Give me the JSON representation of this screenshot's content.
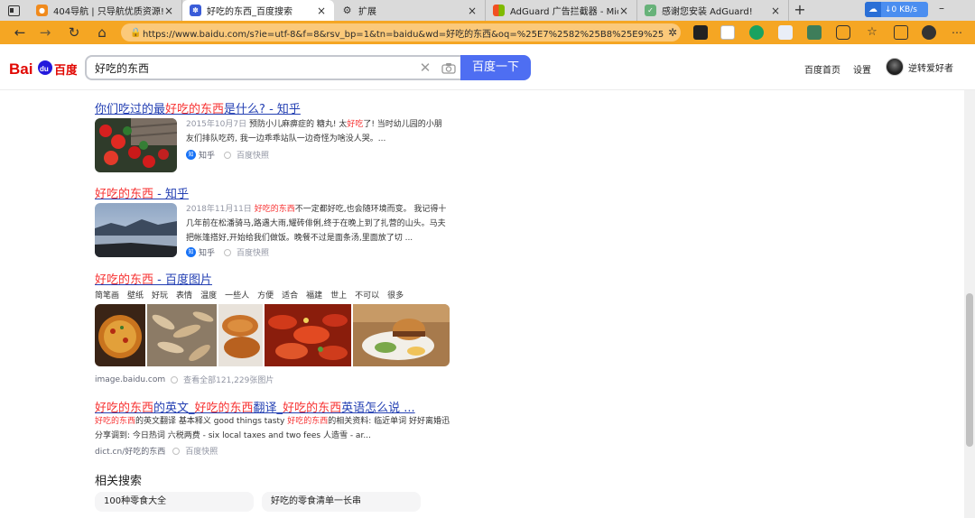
{
  "browser": {
    "tabs": [
      {
        "title": "404导航 | 只导航优质资源!",
        "close": "×"
      },
      {
        "title": "好吃的东西_百度搜索",
        "close": "×"
      },
      {
        "title": "扩展",
        "close": "×"
      },
      {
        "title": "AdGuard 广告拦截器 - Microsoft",
        "close": "×"
      },
      {
        "title": "感谢您安装 AdGuard!",
        "close": "×"
      }
    ],
    "new_tab": "+",
    "cloud_speed": "↓0 KB/s",
    "url": "https://www.baidu.com/s?ie=utf-8&f=8&rsv_bp=1&tn=baidu&wd=好吃的东西&oq=%25E7%2582%25B8%25E9%25B8%25A1...",
    "nav": {
      "back": "←",
      "forward": "→",
      "reload": "↻",
      "home": "⌂"
    }
  },
  "header": {
    "search_query": "好吃的东西",
    "search_button": "百度一下",
    "links": {
      "home": "百度首页",
      "settings": "设置"
    },
    "username": "逆转爱好者"
  },
  "results": [
    {
      "title_pre": "你们吃过的最",
      "title_hl": "好吃的东西",
      "title_post": "是什么? - 知乎",
      "date": "2015年10月7日",
      "snippet_a": "预防小儿麻痹症的 糖丸! 太",
      "snippet_hl": "好吃",
      "snippet_b": "了! 当时幼儿园的小朋友们排队吃药, 我一边乖乖站队一边奇怪为啥没人哭。...",
      "source": "知乎",
      "snapshot": "百度快照"
    },
    {
      "title_hl": "好吃的东西",
      "title_post": " - 知乎",
      "date": "2018年11月11日",
      "snippet_hl": "好吃的东西",
      "snippet_b": "不一定都好吃,也会随环境而变。 我记得十几年前在松潘骑马,路遇大雨,耀砖俳俐,终于在晚上到了扎营的山头。马夫把帐篷搭好,开始给我们做饭。晚餐不过是面条汤,里面放了切 ...",
      "source": "知乎",
      "snapshot": "百度快照"
    }
  ],
  "image_result": {
    "title_hl": "好吃的东西",
    "title_post": " - 百度图片",
    "tags": [
      "简笔画",
      "壁纸",
      "好玩",
      "表情",
      "温度",
      "一些人",
      "方便",
      "适合",
      "福建",
      "世上",
      "不可以",
      "很多"
    ],
    "domain": "image.baidu.com",
    "view_all": "查看全部121,229张图片"
  },
  "dict_result": {
    "t1": "好吃的东西",
    "t2": "的英文_",
    "t3": "好吃的东西",
    "t4": "翻译_",
    "t5": "好吃的东西",
    "t6": "英语怎么说 ...",
    "s_hl1": "好吃的东西",
    "s_a": "的英文翻译 基本释义 good things tasty ",
    "s_hl2": "好吃的东西",
    "s_b": "的相关资料: 临近单词 好好离婚迅分享调到: 今日热词 六税两费 - six local taxes and two fees 人造雪 - ar...",
    "source": "dict.cn/好吃的东西",
    "snapshot": "百度快照"
  },
  "related": {
    "heading": "相关搜索",
    "items": [
      "100种零食大全",
      "好吃的零食清单一长串"
    ]
  },
  "colors": {
    "accent_orange": "#f5a623",
    "baidu_blue": "#4e6ef2",
    "link_blue": "#2440b3",
    "highlight_red": "#f73131"
  }
}
